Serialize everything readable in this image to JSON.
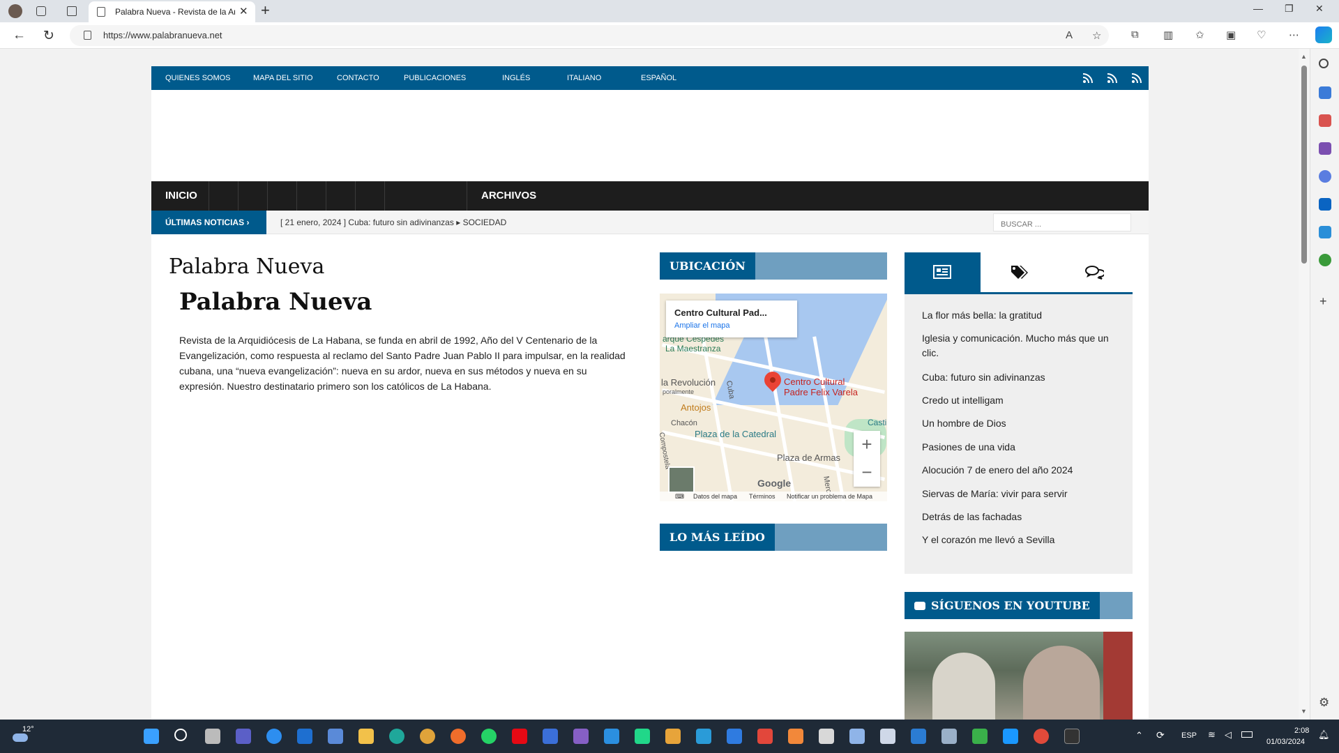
{
  "browser": {
    "tab_title": "Palabra Nueva - Revista de la Arquidiócesis de La Habana",
    "url": "https://www.palabranueva.net"
  },
  "site": {
    "topnav": [
      "QUIENES SOMOS",
      "MAPA DEL SITIO",
      "CONTACTO",
      "PUBLICACIONES",
      "INGLÉS",
      "ITALIANO",
      "ESPAÑOL"
    ],
    "mainnav": {
      "home": "INICIO",
      "archives": "ARCHIVOS"
    },
    "news": {
      "label": "ÚLTIMAS NOTICIAS",
      "date": "[ 21 enero, 2024 ]",
      "headline": "Cuba: futuro sin adivinanzas",
      "category": "SOCIEDAD"
    },
    "search_placeholder": "BUSCAR ...",
    "page_title": "Palabra Nueva",
    "article": {
      "title": "Palabra Nueva",
      "body": "Revista de la Arquidiócesis de La Habana, se funda en abril de 1992, Año del V Centenario de la Evangelización, como respuesta al reclamo del Santo Padre Juan Pablo II para impulsar, en la realidad cubana, una “nueva evangelización”: nueva en su ardor, nueva en sus métodos y nueva en su expresión. Nuestro destinatario primero son los católicos de La Habana."
    },
    "widgets": {
      "location_title": "UBICACIÓN",
      "most_read_title": "LO MÁS LEÍDO",
      "youtube_title": "SÍGUENOS EN YOUTUBE"
    },
    "map": {
      "popup_title": "Centro Cultural Pad...",
      "popup_link": "Ampliar el mapa",
      "pin_label_1": "Centro Cultural",
      "pin_label_2": "Padre Felix Varela",
      "labels": [
        "arque Céspedes",
        "La Maestranza",
        "la Revolución",
        "poralmente",
        "Antojos",
        "Chacón",
        "Plaza de la Catedral",
        "Plaza de Armas",
        "Cuba",
        "Compostela",
        "Merc",
        "Casti"
      ],
      "google": "Google",
      "footer": [
        "Datos del mapa",
        "Términos",
        "Notificar un problema de Mapa"
      ]
    },
    "recent_posts": [
      "La flor más bella: la gratitud",
      "Iglesia y comunicación. Mucho más que un clic.",
      "Cuba: futuro sin adivinanzas",
      "Credo ut intelligam",
      "Un hombre de Dios",
      "Pasiones de una vida",
      "Alocución 7 de enero del año 2024",
      "Siervas de María: vivir para servir",
      "Detrás de las fachadas",
      "Y el corazón me llevó a Sevilla"
    ]
  },
  "taskbar": {
    "temperature": "12°",
    "language": "ESP",
    "time": "2:08",
    "date": "01/03/2024"
  },
  "colors": {
    "brand_blue": "#005a8c",
    "widget_band": "#6f9fc0",
    "dark_nav": "#1d1d1d"
  }
}
